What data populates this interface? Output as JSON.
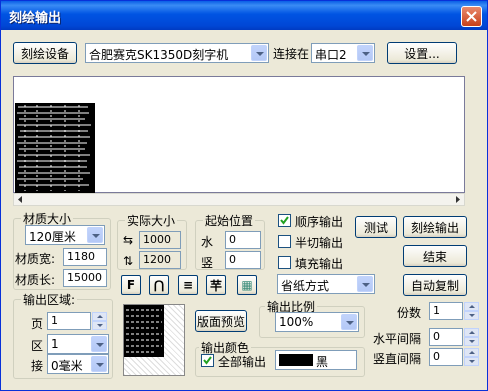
{
  "window": {
    "title": "刻绘输出"
  },
  "top": {
    "device_button": "刻绘设备",
    "device_value": "合肥赛克SK1350D刻字机",
    "connect_label": "连接在",
    "port_value": "串口2",
    "settings_button": "设置..."
  },
  "material": {
    "group_label": "材质大小",
    "size_value": "120厘米",
    "width_label": "材质宽:",
    "width_value": "1180",
    "length_label": "材质长:",
    "length_value": "15000"
  },
  "actual": {
    "group_label": "实际大小",
    "w_icon": "⇆",
    "w_value": "1000",
    "h_icon": "⇅",
    "h_value": "1200"
  },
  "origin": {
    "group_label": "起始位置",
    "x_label": "水",
    "x_value": "0",
    "y_label": "竖",
    "y_value": "0"
  },
  "options": {
    "sequential": "顺序输出",
    "half_cut": "半切输出",
    "fill": "填充输出",
    "paper_mode": "省纸方式"
  },
  "actions": {
    "test": "测试",
    "plot": "刻绘输出",
    "end": "结束",
    "auto_copy": "自动复制"
  },
  "tools": {
    "t1": "F",
    "t2": "⋂",
    "t3": "≡",
    "t4": "芉",
    "t5": "▦"
  },
  "output_area": {
    "group_label": "输出区域:",
    "page_label": "页",
    "page_value": "1",
    "zone_label": "区",
    "zone_value": "1",
    "join_label": "接",
    "join_value": "0毫米"
  },
  "layout_preview_button": "版面预览",
  "scale": {
    "group_label": "输出比例",
    "value": "100%"
  },
  "color": {
    "group_label": "输出颜色",
    "all_output": "全部输出",
    "color_name": "黑",
    "swatch_hex": "#000000"
  },
  "copies": {
    "copies_label": "份数",
    "copies_value": "1",
    "h_gap_label": "水平间隔",
    "h_gap_value": "0",
    "v_gap_label": "竖直间隔",
    "v_gap_value": "0"
  }
}
